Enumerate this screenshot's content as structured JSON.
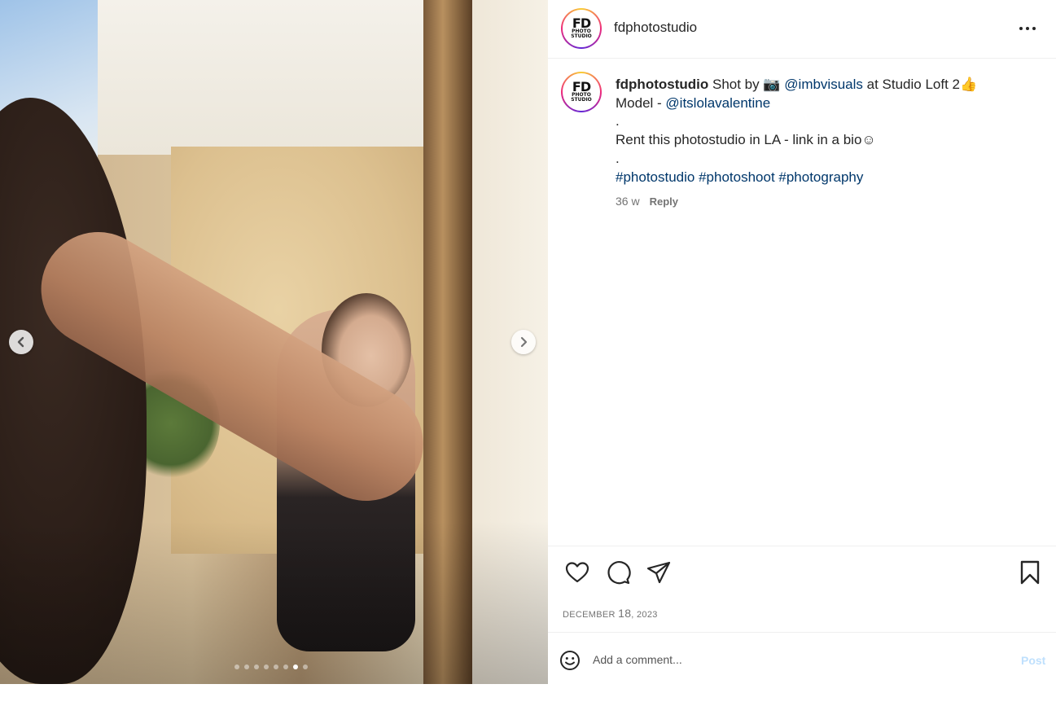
{
  "post": {
    "username": "fdphotostudio",
    "avatar": {
      "logo_top": "FD",
      "logo_line2": "PHOTO",
      "logo_line3": "STUDIO"
    },
    "more_icon": "more-horizontal-icon",
    "media": {
      "description_icon": "photo-carousel",
      "prev_icon": "chevron-left-icon",
      "next_icon": "chevron-right-icon",
      "dot_count": 8,
      "active_dot_index": 6
    },
    "caption": {
      "username": "fdphotostudio",
      "line1_text1": "Shot by",
      "camera_emoji": "📷",
      "mention1": "@imbvisuals",
      "line1_text2": "at Studio Loft 2",
      "thumbs_emoji": "👍",
      "line2_text": "Model -",
      "mention2": "@itslolavalentine",
      "line3": ".",
      "line4_text": "Rent this photostudio in LA - link in a bio",
      "smile_emoji": "☺",
      "line5": ".",
      "hashtags": "#photostudio #photoshoot #photography"
    },
    "meta": {
      "time": "36 w",
      "reply": "Reply"
    },
    "actions": {
      "like_icon": "heart-icon",
      "comment_icon": "comment-icon",
      "share_icon": "send-icon",
      "save_icon": "bookmark-icon"
    },
    "date": {
      "month": "DECEMBER",
      "day": "18",
      "year": "2023"
    },
    "comment_box": {
      "placeholder": "Add a comment...",
      "post_label": "Post",
      "emoji_icon": "smiley-icon"
    }
  },
  "colors": {
    "link": "#00376b",
    "post_button": "#bfe0fd",
    "muted": "#737373"
  }
}
